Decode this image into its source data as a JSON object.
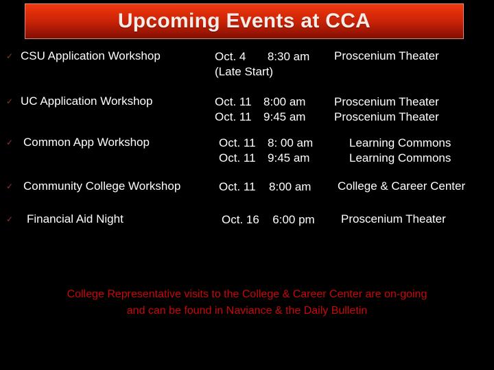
{
  "slide": {
    "title": "Upcoming Events at CCA",
    "background_color": "#000000",
    "title_banner_colors": {
      "gradient_top": "#f03a10",
      "gradient_bottom": "#7c1003",
      "border": "#d98a7a",
      "text": "#f7ece8"
    },
    "bullet_icon": "check-icon",
    "bullet_glyph": "✓",
    "bullet_color": "#8a3b2b",
    "body_text_color": "#ffffff",
    "footer_color": "#c7080b"
  },
  "events": [
    {
      "name": "CSU Application Workshop",
      "date": "Oct. 4",
      "time": "8:30 am",
      "location": "Proscenium Theater",
      "note": "(Late Start)",
      "extra": null
    },
    {
      "name": "UC Application Workshop",
      "date": "Oct. 11",
      "time": "8:00 am",
      "location": "Proscenium Theater",
      "note": null,
      "extra": {
        "date": "Oct. 11",
        "time": "9:45 am",
        "location": "Proscenium Theater"
      }
    },
    {
      "name": "Common App Workshop",
      "date": "Oct. 11",
      "time": "8: 00 am",
      "location": "Learning Commons",
      "note": null,
      "extra": {
        "date": "Oct. 11",
        "time": "9:45 am",
        "location": "Learning Commons"
      }
    },
    {
      "name": "Community College Workshop",
      "date": "Oct. 11",
      "time": "8:00 am",
      "location": "College & Career Center",
      "note": null,
      "extra": null
    },
    {
      "name": "Financial Aid Night",
      "date": "Oct. 16",
      "time": "6:00 pm",
      "location": "Proscenium Theater",
      "note": null,
      "extra": null
    }
  ],
  "footer": {
    "line1": "College Representative visits to the College & Career Center are on-going",
    "line2": "and can be found in Naviance & the Daily Bulletin"
  }
}
